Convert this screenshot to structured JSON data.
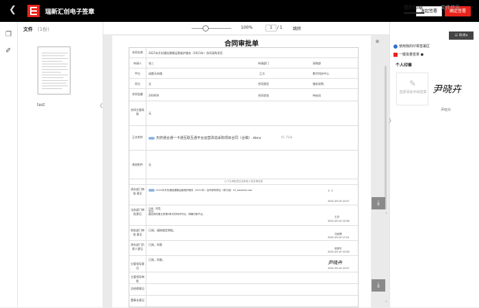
{
  "app": {
    "title": "瑞新汇创电子签章",
    "launch_label": "发起签署",
    "sign_label": "确定签署"
  },
  "files": {
    "title": "文件",
    "count": "(1份)",
    "items": [
      {
        "name": "test"
      }
    ]
  },
  "toolbar": {
    "zoom": "100%",
    "page_current": "1",
    "page_total": "/ 1",
    "jump_label": "跳转"
  },
  "document": {
    "title": "合同审批单",
    "rows": [
      {
        "label": "合同名称",
        "value": "2021年开封通信建模运营维护服务（2021年）合同采购项目"
      },
      {
        "label": "申请人",
        "value": "张三",
        "label2": "申请部门",
        "value2": "采购部"
      },
      {
        "label": "甲方",
        "value": "成都天府通",
        "label2": "乙方",
        "value2": "数字科技中心"
      },
      {
        "label": "丙方",
        "value": "无",
        "label2": "合同类型",
        "value2": "服务采购"
      },
      {
        "label": "合同金额",
        "value": "200000",
        "label2": "合同状态",
        "value2": "待启动"
      },
      {
        "label": "合同主要条款",
        "value": "无"
      },
      {
        "label": "正文附件",
        "value": "天府通合通一卡通互联互通平台运营改造采购项目合同（合稿）.docx",
        "size": "91.75kb"
      },
      {
        "label": "其他附件",
        "value": "无"
      }
    ],
    "approval_header": "以下为审批意见及审批人签名等信息",
    "approvals": [
      {
        "label": "承办部门审批 意见",
        "value": "2021年开封通信建模运营维护服务（2021年）合同采购项目（修订版）V2_baseline.doc",
        "who": "",
        "date": "2021-09-10 10:27"
      },
      {
        "label": "法务部门审批意见",
        "value": "已阅，同意。\n意见：\n建议修改第五条第5条中的时间节点，明确付款节点。",
        "who": "王总",
        "date": "2021-09-10 10:28"
      },
      {
        "label": "财务部门审批 意见",
        "value": "已阅，请按规定审批。",
        "who": "刘经理",
        "date": "2021-09-10 17:01"
      },
      {
        "label": "承办部门负责人意见",
        "value": "已阅，同意",
        "who": "赵部长",
        "date": "2021-09-10 10:28"
      },
      {
        "label": "分管领导意见",
        "value": "已阅，同意。",
        "who": "",
        "date": "2021-09-10 10:27"
      },
      {
        "label": "主要领导审批",
        "value": "",
        "who": "",
        "date": ""
      },
      {
        "label": "总经理意见",
        "value": "",
        "who": "",
        "date": ""
      },
      {
        "label": "董事长意见",
        "value": "",
        "who": "",
        "date": ""
      }
    ]
  },
  "right_panel": {
    "tab_active": "我的印章",
    "tab_inactive": "文件信息",
    "lang_label": "中/En",
    "option1": "使用我的印章签署区",
    "option2": "一键批量签章",
    "personal_title": "个人印章",
    "add_signature": "选择添加手绘签章",
    "signature_name": "尹晓卉"
  },
  "icons": {
    "back": "chevron-left-icon",
    "files": "document-icon",
    "attachment": "paperclip-icon",
    "pen": "pen-icon",
    "download": "download-icon"
  },
  "colors": {
    "accent": "#e8231b",
    "topbar": "#000000",
    "info": "#2f6fcf"
  }
}
